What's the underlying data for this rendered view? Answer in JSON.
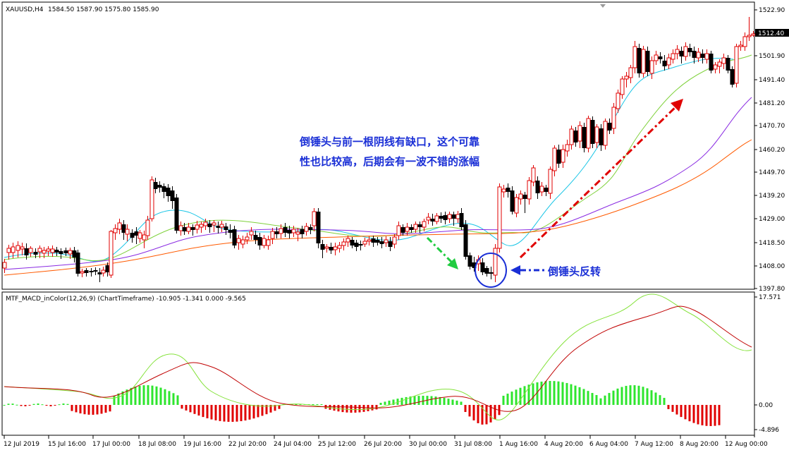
{
  "main": {
    "symbol_label": "XAUUSD,H4",
    "ohlc_label": "1584.50 1587.90 1575.80 1585.90",
    "annotation_line1": "倒锤头与前一根阴线有缺口，这个可靠",
    "annotation_line2": "性也比较高，后期会有一波不错的涨幅",
    "callout": "倒锤头反转",
    "colors": {
      "bull": "#e00000",
      "bear": "#000000",
      "ma_cyan": "#19c5e6",
      "ma_green": "#7fd13b",
      "ma_purple": "#8a2be2",
      "ma_orange": "#ff5a00",
      "annotation": "#1a2fd6",
      "arrow_green": "#20cc40",
      "arrow_red": "#e00000"
    }
  },
  "indicator": {
    "label": "MTF_MACD_inColor(12,26,9) (ChartTimeframe) -10.905 -1.341 0.000 -9.565",
    "colors": {
      "hist_pos": "#2ee52e",
      "hist_neg": "#e00000",
      "signal_green": "#84e23a",
      "macd_red": "#c00000"
    }
  },
  "axes": {
    "price_ticks": [
      "1522.90",
      "1512.40",
      "1501.90",
      "1491.40",
      "1481.20",
      "1470.70",
      "1460.20",
      "1449.70",
      "1439.20",
      "1429.00",
      "1418.50",
      "1408.00",
      "1397.80"
    ],
    "price_current": "1512.40",
    "indicator_ticks": [
      "17.571",
      "0.00",
      "-4.896"
    ],
    "time_ticks": [
      "12 Jul 2019",
      "15 Jul 16:00",
      "17 Jul 00:00",
      "18 Jul 08:00",
      "19 Jul 16:00",
      "22 Jul 20:00",
      "24 Jul 04:00",
      "25 Jul 12:00",
      "26 Jul 20:00",
      "30 Jul 00:00",
      "31 Jul 08:00",
      "1 Aug 16:00",
      "4 Aug 20:00",
      "6 Aug 04:00",
      "7 Aug 12:00",
      "8 Aug 20:00",
      "12 Aug 00:00"
    ]
  }
}
